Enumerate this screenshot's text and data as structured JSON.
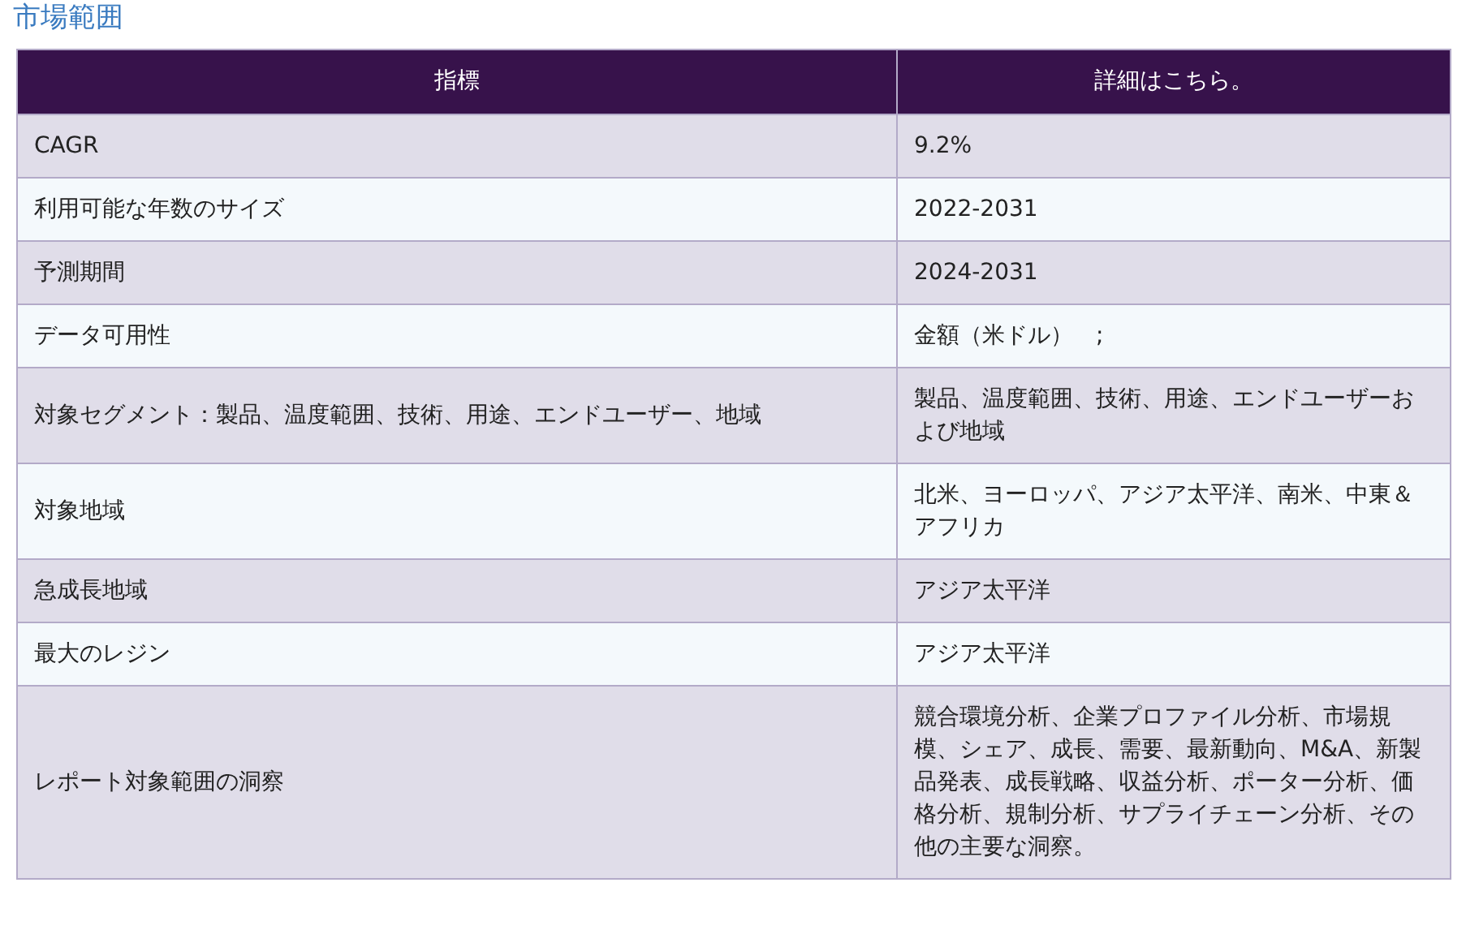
{
  "title": "市場範囲",
  "table": {
    "columns": [
      "指標",
      "詳細はこちら。"
    ],
    "rows": [
      {
        "cells": [
          "CAGR",
          "9.2%"
        ]
      },
      {
        "cells": [
          "利用可能な年数のサイズ",
          "2022-2031"
        ]
      },
      {
        "cells": [
          "予測期間",
          "2024-2031"
        ]
      },
      {
        "cells": [
          "データ可用性",
          "金額（米ドル）　;"
        ]
      },
      {
        "cells": [
          "対象セグメント：製品、温度範囲、技術、用途、エンドユーザー、地域",
          "製品、温度範囲、技術、用途、エンドユーザーおよび地域"
        ]
      },
      {
        "cells": [
          "対象地域",
          "北米、ヨーロッパ、アジア太平洋、南米、中東＆アフリカ"
        ]
      },
      {
        "cells": [
          "急成長地域",
          "アジア太平洋"
        ]
      },
      {
        "cells": [
          "最大のレジン",
          "アジア太平洋"
        ]
      },
      {
        "cells": [
          "レポート対象範囲の洞察",
          "競合環境分析、企業プロファイル分析、市場規模、シェア、成長、需要、最新動向、M&A、新製品発表、成長戦略、収益分析、ポーター分析、価格分析、規制分析、サプライチェーン分析、その他の主要な洞察。"
        ]
      }
    ]
  }
}
